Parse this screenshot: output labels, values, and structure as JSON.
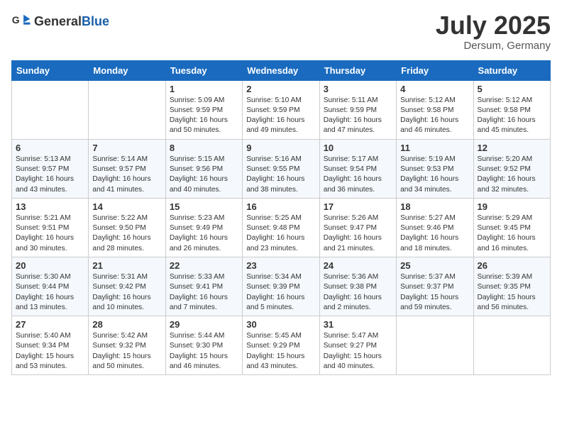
{
  "logo": {
    "general": "General",
    "blue": "Blue"
  },
  "header": {
    "month_year": "July 2025",
    "location": "Dersum, Germany"
  },
  "days_of_week": [
    "Sunday",
    "Monday",
    "Tuesday",
    "Wednesday",
    "Thursday",
    "Friday",
    "Saturday"
  ],
  "weeks": [
    [
      {
        "day": "",
        "content": ""
      },
      {
        "day": "",
        "content": ""
      },
      {
        "day": "1",
        "content": "Sunrise: 5:09 AM\nSunset: 9:59 PM\nDaylight: 16 hours and 50 minutes."
      },
      {
        "day": "2",
        "content": "Sunrise: 5:10 AM\nSunset: 9:59 PM\nDaylight: 16 hours and 49 minutes."
      },
      {
        "day": "3",
        "content": "Sunrise: 5:11 AM\nSunset: 9:59 PM\nDaylight: 16 hours and 47 minutes."
      },
      {
        "day": "4",
        "content": "Sunrise: 5:12 AM\nSunset: 9:58 PM\nDaylight: 16 hours and 46 minutes."
      },
      {
        "day": "5",
        "content": "Sunrise: 5:12 AM\nSunset: 9:58 PM\nDaylight: 16 hours and 45 minutes."
      }
    ],
    [
      {
        "day": "6",
        "content": "Sunrise: 5:13 AM\nSunset: 9:57 PM\nDaylight: 16 hours and 43 minutes."
      },
      {
        "day": "7",
        "content": "Sunrise: 5:14 AM\nSunset: 9:57 PM\nDaylight: 16 hours and 41 minutes."
      },
      {
        "day": "8",
        "content": "Sunrise: 5:15 AM\nSunset: 9:56 PM\nDaylight: 16 hours and 40 minutes."
      },
      {
        "day": "9",
        "content": "Sunrise: 5:16 AM\nSunset: 9:55 PM\nDaylight: 16 hours and 38 minutes."
      },
      {
        "day": "10",
        "content": "Sunrise: 5:17 AM\nSunset: 9:54 PM\nDaylight: 16 hours and 36 minutes."
      },
      {
        "day": "11",
        "content": "Sunrise: 5:19 AM\nSunset: 9:53 PM\nDaylight: 16 hours and 34 minutes."
      },
      {
        "day": "12",
        "content": "Sunrise: 5:20 AM\nSunset: 9:52 PM\nDaylight: 16 hours and 32 minutes."
      }
    ],
    [
      {
        "day": "13",
        "content": "Sunrise: 5:21 AM\nSunset: 9:51 PM\nDaylight: 16 hours and 30 minutes."
      },
      {
        "day": "14",
        "content": "Sunrise: 5:22 AM\nSunset: 9:50 PM\nDaylight: 16 hours and 28 minutes."
      },
      {
        "day": "15",
        "content": "Sunrise: 5:23 AM\nSunset: 9:49 PM\nDaylight: 16 hours and 26 minutes."
      },
      {
        "day": "16",
        "content": "Sunrise: 5:25 AM\nSunset: 9:48 PM\nDaylight: 16 hours and 23 minutes."
      },
      {
        "day": "17",
        "content": "Sunrise: 5:26 AM\nSunset: 9:47 PM\nDaylight: 16 hours and 21 minutes."
      },
      {
        "day": "18",
        "content": "Sunrise: 5:27 AM\nSunset: 9:46 PM\nDaylight: 16 hours and 18 minutes."
      },
      {
        "day": "19",
        "content": "Sunrise: 5:29 AM\nSunset: 9:45 PM\nDaylight: 16 hours and 16 minutes."
      }
    ],
    [
      {
        "day": "20",
        "content": "Sunrise: 5:30 AM\nSunset: 9:44 PM\nDaylight: 16 hours and 13 minutes."
      },
      {
        "day": "21",
        "content": "Sunrise: 5:31 AM\nSunset: 9:42 PM\nDaylight: 16 hours and 10 minutes."
      },
      {
        "day": "22",
        "content": "Sunrise: 5:33 AM\nSunset: 9:41 PM\nDaylight: 16 hours and 7 minutes."
      },
      {
        "day": "23",
        "content": "Sunrise: 5:34 AM\nSunset: 9:39 PM\nDaylight: 16 hours and 5 minutes."
      },
      {
        "day": "24",
        "content": "Sunrise: 5:36 AM\nSunset: 9:38 PM\nDaylight: 16 hours and 2 minutes."
      },
      {
        "day": "25",
        "content": "Sunrise: 5:37 AM\nSunset: 9:37 PM\nDaylight: 15 hours and 59 minutes."
      },
      {
        "day": "26",
        "content": "Sunrise: 5:39 AM\nSunset: 9:35 PM\nDaylight: 15 hours and 56 minutes."
      }
    ],
    [
      {
        "day": "27",
        "content": "Sunrise: 5:40 AM\nSunset: 9:34 PM\nDaylight: 15 hours and 53 minutes."
      },
      {
        "day": "28",
        "content": "Sunrise: 5:42 AM\nSunset: 9:32 PM\nDaylight: 15 hours and 50 minutes."
      },
      {
        "day": "29",
        "content": "Sunrise: 5:44 AM\nSunset: 9:30 PM\nDaylight: 15 hours and 46 minutes."
      },
      {
        "day": "30",
        "content": "Sunrise: 5:45 AM\nSunset: 9:29 PM\nDaylight: 15 hours and 43 minutes."
      },
      {
        "day": "31",
        "content": "Sunrise: 5:47 AM\nSunset: 9:27 PM\nDaylight: 15 hours and 40 minutes."
      },
      {
        "day": "",
        "content": ""
      },
      {
        "day": "",
        "content": ""
      }
    ]
  ]
}
